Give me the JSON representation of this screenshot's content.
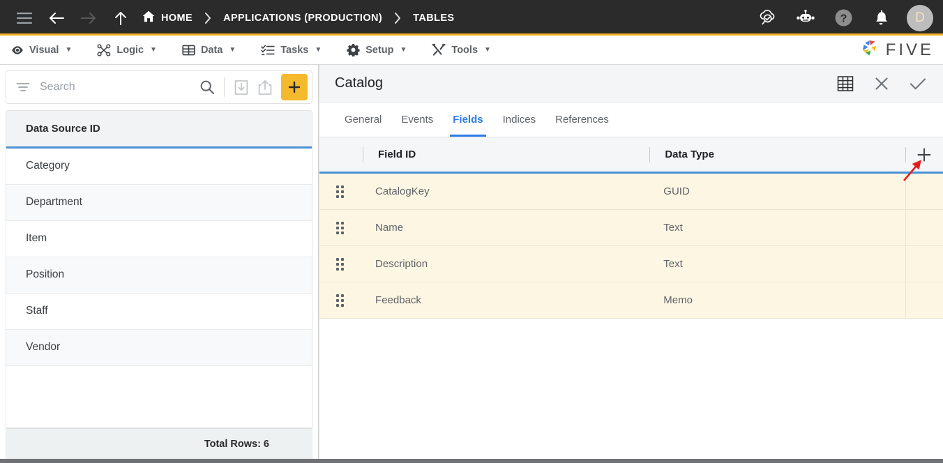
{
  "topbar": {
    "menu_icon": "hamburger-icon",
    "back_label": "Back",
    "forward_label": "Forward",
    "up_label": "Up",
    "breadcrumbs": [
      {
        "label": "HOME",
        "icon": "home-icon"
      },
      {
        "label": "APPLICATIONS (PRODUCTION)",
        "icon": ""
      },
      {
        "label": "TABLES",
        "icon": ""
      }
    ],
    "separator": "›",
    "right_icons": [
      {
        "name": "cloud-search-icon",
        "label": "Cloud Search"
      },
      {
        "name": "chatbot-icon",
        "label": "Assistant"
      },
      {
        "name": "help-icon",
        "label": "Help"
      },
      {
        "name": "notifications-bell-icon",
        "label": "Notifications"
      }
    ],
    "avatar_initial": "D",
    "accent_color": "#f5b324",
    "background_color": "#2b2b2b"
  },
  "menubar": {
    "items": [
      {
        "label": "Visual",
        "icon": "eye-icon",
        "caret": "▼"
      },
      {
        "label": "Logic",
        "icon": "logic-nodes-icon",
        "caret": "▼"
      },
      {
        "label": "Data",
        "icon": "table-grid-icon",
        "caret": "▼"
      },
      {
        "label": "Tasks",
        "icon": "checklist-icon",
        "caret": "▼"
      },
      {
        "label": "Setup",
        "icon": "gear-icon",
        "caret": "▼"
      },
      {
        "label": "Tools",
        "icon": "tools-icon",
        "caret": "▼"
      }
    ],
    "brand": "FIVE",
    "brand_icon": "five-pinwheel-logo"
  },
  "sidebar": {
    "search": {
      "placeholder": "Search",
      "value": "",
      "filter_icon": "filter-icon",
      "search_icon": "search-icon",
      "import_icon": "import-download-icon",
      "export_icon": "export-share-icon",
      "add_icon": "plus-icon",
      "add_button_color": "#f5b92e"
    },
    "column_header": "Data Source ID",
    "items": [
      {
        "label": "Category"
      },
      {
        "label": "Department"
      },
      {
        "label": "Item"
      },
      {
        "label": "Position"
      },
      {
        "label": "Staff"
      },
      {
        "label": "Vendor"
      }
    ],
    "total_rows_label": "Total Rows: 6"
  },
  "panel": {
    "title": "Catalog",
    "header_icons": [
      {
        "name": "table-view-icon",
        "label": "Table View"
      },
      {
        "name": "close-icon",
        "label": "Close"
      },
      {
        "name": "confirm-check-icon",
        "label": "Save"
      }
    ],
    "tabs": [
      {
        "label": "General",
        "active": false
      },
      {
        "label": "Events",
        "active": false
      },
      {
        "label": "Fields",
        "active": true
      },
      {
        "label": "Indices",
        "active": false
      },
      {
        "label": "References",
        "active": false
      }
    ],
    "active_tab_color": "#2b7de9",
    "grid": {
      "columns": [
        "Field ID",
        "Data Type"
      ],
      "add_row_icon": "plus-icon",
      "row_background": "#fdf6e3",
      "rows": [
        {
          "field_id": "CatalogKey",
          "data_type": "GUID"
        },
        {
          "field_id": "Name",
          "data_type": "Text"
        },
        {
          "field_id": "Description",
          "data_type": "Text"
        },
        {
          "field_id": "Feedback",
          "data_type": "Memo"
        }
      ]
    }
  },
  "annotation": {
    "arrow_color": "#e81b1b",
    "target": "add-field-button"
  }
}
